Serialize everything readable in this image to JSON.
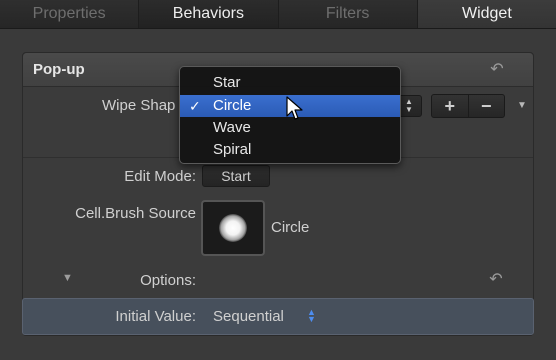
{
  "tabs": [
    {
      "label": "Properties"
    },
    {
      "label": "Behaviors"
    },
    {
      "label": "Filters"
    },
    {
      "label": "Widget"
    }
  ],
  "panel": {
    "title": "Pop-up",
    "wipe_shape_label": "Wipe Shap",
    "edit_mode_label": "Edit Mode:",
    "edit_mode_button": "Start",
    "brush_source_label": "Cell.Brush Source",
    "brush_source_value": "Circle",
    "options_label": "Options:",
    "initial_value_label": "Initial Value:",
    "initial_value": "Sequential",
    "plus_label": "+",
    "minus_label": "−"
  },
  "menu": {
    "items": [
      "Star",
      "Circle",
      "Wave",
      "Spiral"
    ],
    "selected": "Circle",
    "check": "✓"
  },
  "colors": {
    "accent_blue": "#2b5bb5",
    "highlight_row": "#47505c",
    "updown_blue": "#4d8df0"
  }
}
